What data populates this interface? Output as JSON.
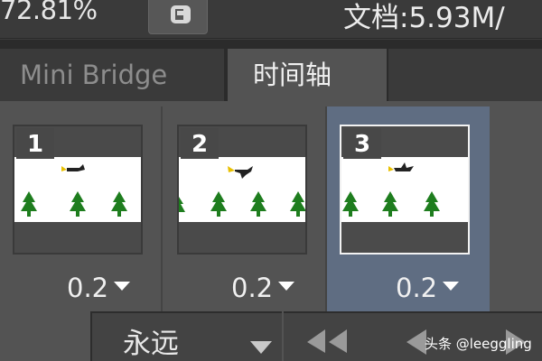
{
  "statusbar": {
    "zoom": "72.81%",
    "doc_info": "文档:5.93M/",
    "menu_icon": "status-menu-icon"
  },
  "tabs": [
    {
      "label": "Mini Bridge",
      "active": false
    },
    {
      "label": "时间轴",
      "active": true
    }
  ],
  "frames": [
    {
      "number": "1",
      "delay": "0.2",
      "selected": false
    },
    {
      "number": "2",
      "delay": "0.2",
      "selected": false
    },
    {
      "number": "3",
      "delay": "0.2",
      "selected": true
    }
  ],
  "controls": {
    "loop_value": "永远",
    "nav_icons": [
      "rewind-icon",
      "previous-frame-icon",
      "next-frame-icon"
    ]
  },
  "watermark": "头条 @leeggling",
  "colors": {
    "panel_bg": "#535353",
    "selected_frame_bg": "#5f6d82",
    "tree_green": "#1e7d1e"
  }
}
